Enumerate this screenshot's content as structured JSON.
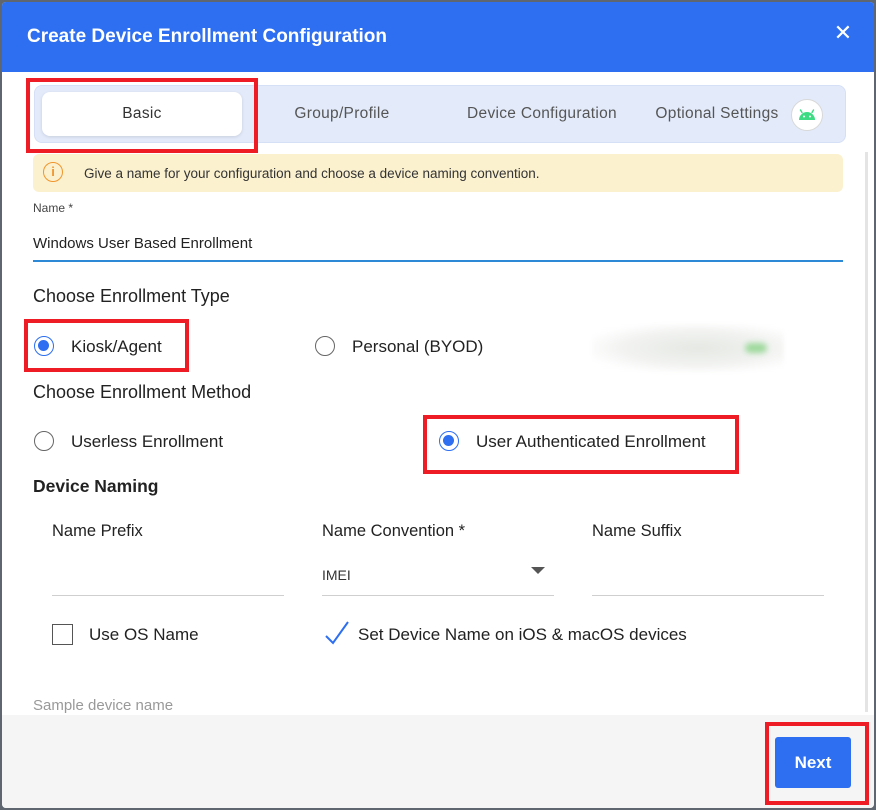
{
  "dialog": {
    "title": "Create Device Enrollment Configuration",
    "close_label": "✕"
  },
  "tabs": [
    {
      "label": "Basic",
      "active": true
    },
    {
      "label": "Group/Profile",
      "active": false
    },
    {
      "label": "Device Configuration",
      "active": false
    },
    {
      "label": "Optional Settings",
      "active": false,
      "icon": "android-icon"
    }
  ],
  "info": {
    "icon": "info-icon",
    "icon_glyph": "i",
    "text": "Give a name for your configuration and choose a device naming convention."
  },
  "name_field": {
    "label": "Name *",
    "value": "Windows User Based Enrollment"
  },
  "enrollment_type": {
    "title": "Choose Enrollment Type",
    "options": [
      {
        "label": "Kiosk/Agent",
        "selected": true
      },
      {
        "label": "Personal (BYOD)",
        "selected": false
      }
    ]
  },
  "enrollment_method": {
    "title": "Choose Enrollment Method",
    "options": [
      {
        "label": "Userless Enrollment",
        "selected": false
      },
      {
        "label": "User Authenticated Enrollment",
        "selected": true
      }
    ]
  },
  "device_naming": {
    "title": "Device Naming",
    "prefix_label": "Name Prefix",
    "prefix_value": "",
    "convention_label": "Name Convention *",
    "convention_value": "IMEI",
    "suffix_label": "Name Suffix",
    "suffix_value": "",
    "use_os_name": {
      "label": "Use OS Name",
      "checked": false
    },
    "set_device_name": {
      "label": "Set Device Name on iOS & macOS devices",
      "checked": true
    },
    "sample_label": "Sample device name"
  },
  "footer": {
    "next_label": "Next"
  },
  "colors": {
    "primary": "#2d6ff0",
    "highlight": "#ee1c25",
    "info_bg": "#fbf1cf",
    "info_icon": "#f0962d",
    "android": "#3ddc84"
  }
}
